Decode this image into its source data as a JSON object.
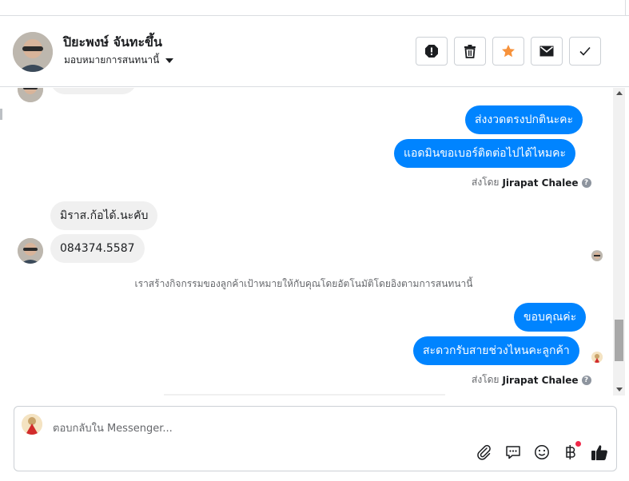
{
  "contact": {
    "name": "ปิยะพงษ์ จันทะขึ้น",
    "assign_label": "มอบหมายการสนทนานี้"
  },
  "actions": [
    {
      "icon": "spam-icon"
    },
    {
      "icon": "trash-icon"
    },
    {
      "icon": "star-icon"
    },
    {
      "icon": "mail-icon"
    },
    {
      "icon": "check-icon"
    }
  ],
  "messages": {
    "out_1": "ส่งงวดตรงปกตินะคะ",
    "out_2": "แอดมินขอเบอร์ติดต่อไปได้ไหมคะ",
    "sent_by_prefix_1": "ส่งโดย",
    "sent_by_name_1": "Jirapat Chalee",
    "in_1": "มิราส.ก้อได้.นะคับ",
    "in_2": "084374.5587",
    "system_note": "เราสร้างกิจกรรมของลูกค้าเป้าหมายให้กับคุณโดยอัตโนมัติโดยอิงตามการสนทนานี้",
    "out_3": "ขอบคุณค่ะ",
    "out_4": "สะดวกรับสายช่วงไหนคะลูกค้า",
    "sent_by_prefix_2": "ส่งโดย",
    "sent_by_name_2": "Jirapat Chalee",
    "help_glyph": "?"
  },
  "composer": {
    "placeholder": "ตอบกลับใน Messenger..."
  },
  "tools": [
    "attachment-icon",
    "saved-reply-icon",
    "emoji-icon",
    "payment-icon",
    "like-icon"
  ],
  "colors": {
    "outgoing": "#0084ff",
    "incoming": "#f0f0f0",
    "star": "#f7923b",
    "badge": "#f02849"
  }
}
